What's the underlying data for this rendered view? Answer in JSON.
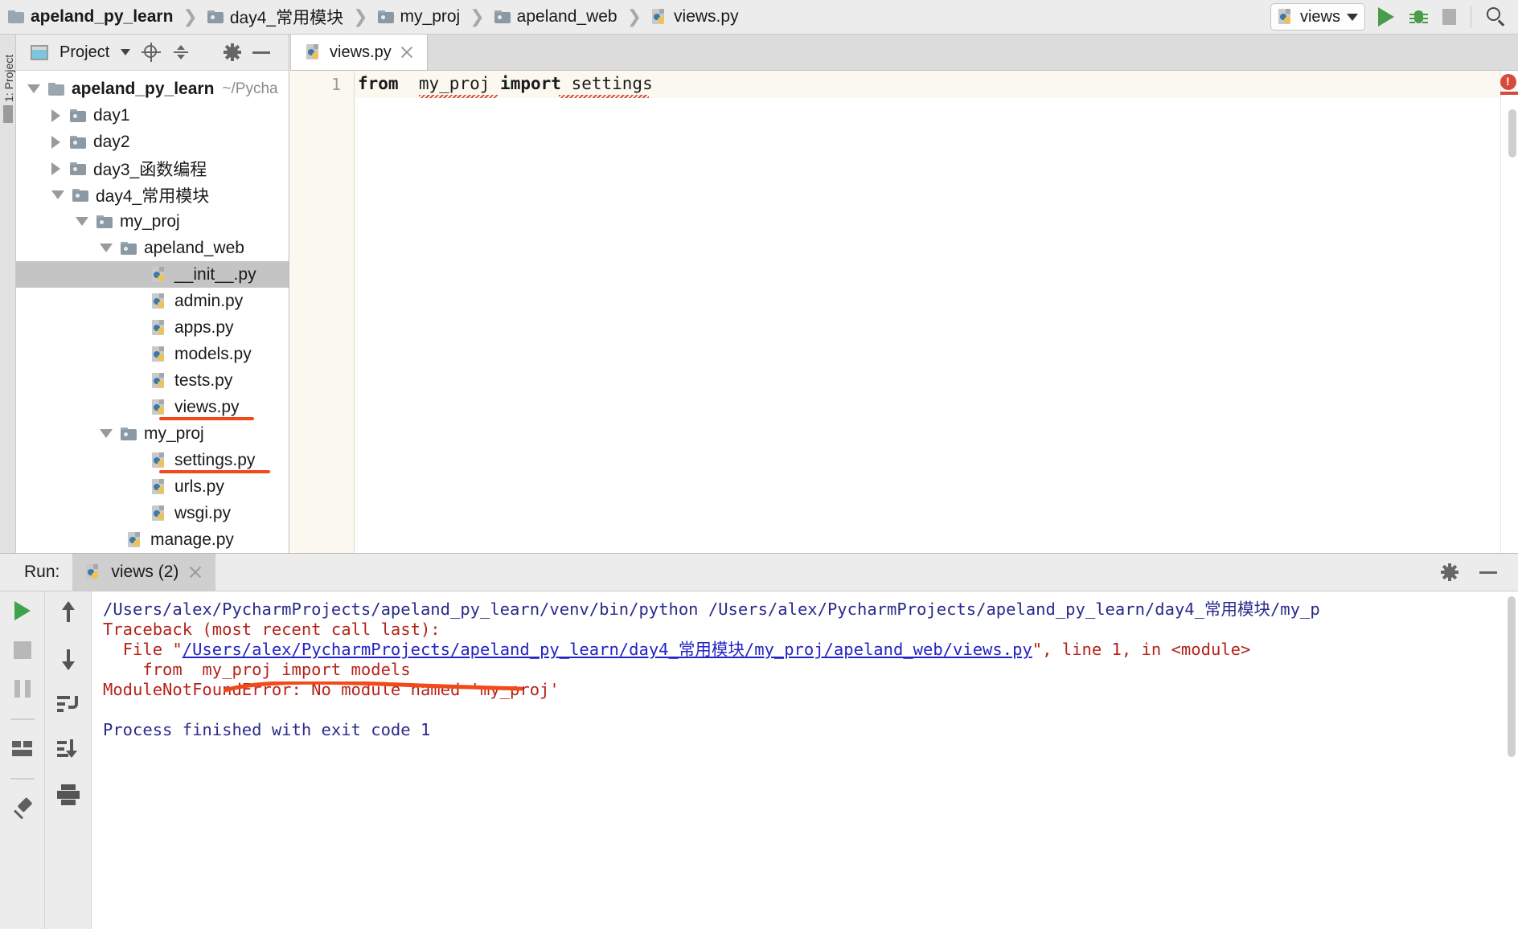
{
  "breadcrumb": {
    "items": [
      {
        "label": "apeland_py_learn",
        "icon": "folder-icon",
        "bold": true
      },
      {
        "label": "day4_常用模块",
        "icon": "folder-icon",
        "bold": false
      },
      {
        "label": "my_proj",
        "icon": "folder-icon",
        "bold": false
      },
      {
        "label": "apeland_web",
        "icon": "folder-icon",
        "bold": false
      },
      {
        "label": "views.py",
        "icon": "python-file-icon",
        "bold": false
      }
    ],
    "separator": "❯"
  },
  "toolbar": {
    "run_config": "views",
    "run_button": "run-button",
    "debug_button": "debug-button",
    "stop_button": "stop-button",
    "search_button": "search-everywhere-button"
  },
  "left_strip": {
    "label": "1: Project"
  },
  "project_panel": {
    "title": "Project",
    "icons": [
      "locate-icon",
      "collapse-all-icon",
      "gear-icon",
      "minimize-icon"
    ],
    "tree": [
      {
        "label": "apeland_py_learn",
        "path_hint": "~/Pycha",
        "icon": "folder-icon",
        "indent": 0,
        "expander": "down",
        "bold": true,
        "selected": false,
        "underline": false
      },
      {
        "label": "day1",
        "icon": "folder-icon",
        "indent": 1,
        "expander": "right",
        "bold": false,
        "selected": false,
        "underline": false
      },
      {
        "label": "day2",
        "icon": "folder-icon",
        "indent": 1,
        "expander": "right",
        "bold": false,
        "selected": false,
        "underline": false
      },
      {
        "label": "day3_函数编程",
        "icon": "folder-icon",
        "indent": 1,
        "expander": "right",
        "bold": false,
        "selected": false,
        "underline": false
      },
      {
        "label": "day4_常用模块",
        "icon": "folder-icon",
        "indent": 1,
        "expander": "down",
        "bold": false,
        "selected": false,
        "underline": false
      },
      {
        "label": "my_proj",
        "icon": "folder-icon",
        "indent": 2,
        "expander": "down",
        "bold": false,
        "selected": false,
        "underline": false
      },
      {
        "label": "apeland_web",
        "icon": "folder-icon",
        "indent": 3,
        "expander": "down",
        "bold": false,
        "selected": false,
        "underline": false
      },
      {
        "label": "__init__.py",
        "icon": "python-file-icon",
        "indent": 4,
        "expander": "none",
        "bold": false,
        "selected": true,
        "underline": false
      },
      {
        "label": "admin.py",
        "icon": "python-file-icon",
        "indent": 4,
        "expander": "none",
        "bold": false,
        "selected": false,
        "underline": false
      },
      {
        "label": "apps.py",
        "icon": "python-file-icon",
        "indent": 4,
        "expander": "none",
        "bold": false,
        "selected": false,
        "underline": false
      },
      {
        "label": "models.py",
        "icon": "python-file-icon",
        "indent": 4,
        "expander": "none",
        "bold": false,
        "selected": false,
        "underline": false
      },
      {
        "label": "tests.py",
        "icon": "python-file-icon",
        "indent": 4,
        "expander": "none",
        "bold": false,
        "selected": false,
        "underline": false
      },
      {
        "label": "views.py",
        "icon": "python-file-icon",
        "indent": 4,
        "expander": "none",
        "bold": false,
        "selected": false,
        "underline": true
      },
      {
        "label": "my_proj",
        "icon": "folder-icon",
        "indent": 3,
        "expander": "down",
        "bold": false,
        "selected": false,
        "underline": false
      },
      {
        "label": "settings.py",
        "icon": "python-file-icon",
        "indent": 4,
        "expander": "none",
        "bold": false,
        "selected": false,
        "underline": true
      },
      {
        "label": "urls.py",
        "icon": "python-file-icon",
        "indent": 4,
        "expander": "none",
        "bold": false,
        "selected": false,
        "underline": false
      },
      {
        "label": "wsgi.py",
        "icon": "python-file-icon",
        "indent": 4,
        "expander": "none",
        "bold": false,
        "selected": false,
        "underline": false
      },
      {
        "label": "manage.py",
        "icon": "python-file-icon",
        "indent": 3,
        "expander": "none",
        "bold": false,
        "selected": false,
        "underline": false
      }
    ]
  },
  "editor": {
    "tab_label": "views.py",
    "line_number": "1",
    "code": {
      "kw_from": "from",
      "module": "my_proj",
      "kw_import": "import",
      "imported": "settings",
      "full": "from  my_proj import settings"
    },
    "error_marker": "error-badge"
  },
  "run_panel": {
    "label": "Run:",
    "tab_label": "views (2)",
    "header_icons": [
      "gear-icon",
      "minimize-icon"
    ],
    "left_tools": [
      "rerun-button",
      "stop-button",
      "pause-button",
      "layout-button",
      "pin-button"
    ],
    "right_tools": [
      "scroll-up-button",
      "scroll-down-button",
      "soft-wrap-button",
      "scroll-to-end-button",
      "print-button"
    ],
    "console": [
      {
        "text": "/Users/alex/PycharmProjects/apeland_py_learn/venv/bin/python /Users/alex/PycharmProjects/apeland_py_learn/day4_常用模块/my_p",
        "color": "navy"
      },
      {
        "text": "Traceback (most recent call last):",
        "color": "red"
      },
      {
        "text": "  File \"",
        "color": "red",
        "link": "/Users/alex/PycharmProjects/apeland_py_learn/day4_常用模块/my_proj/apeland_web/views.py",
        "tail": "\", line 1, in <module>"
      },
      {
        "text": "    from  my_proj import models",
        "color": "red"
      },
      {
        "text": "ModuleNotFoundError: No module named 'my_proj'",
        "color": "red"
      },
      {
        "text": "",
        "color": "red"
      },
      {
        "text": "Process finished with exit code 1",
        "color": "navy"
      }
    ]
  },
  "annotations": {
    "color": "#f2491b",
    "marks": [
      "views-py-underline",
      "settings-py-underline",
      "error-message-underline"
    ]
  }
}
